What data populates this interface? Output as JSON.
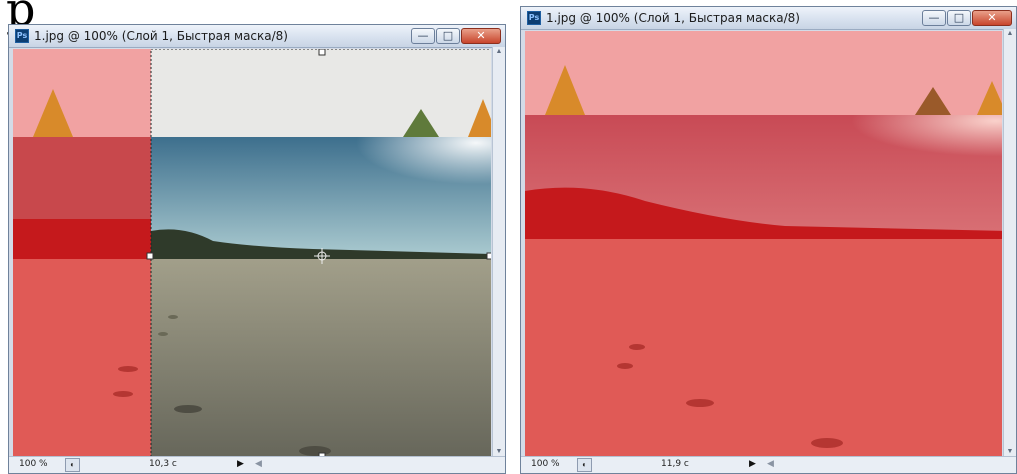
{
  "page": {
    "letter": "р"
  },
  "windows": [
    {
      "id": "left",
      "title": "1.jpg @ 100% (Слой 1, Быстрая маска/8)",
      "app_icon_text": "Ps",
      "status": {
        "zoom": "100 %",
        "info": "10,3 с"
      }
    },
    {
      "id": "right",
      "title": "1.jpg @ 100% (Слой 1, Быстрая маска/8)",
      "app_icon_text": "Ps",
      "status": {
        "zoom": "100 %",
        "info": "11,9 с"
      }
    }
  ],
  "controls": {
    "minimize_glyph": "—",
    "maximize_glyph": "□",
    "close_glyph": "✕",
    "play_glyph": "▶",
    "scroll_left_glyph": "◀",
    "scroll_up_glyph": "▲",
    "scroll_down_glyph": "▼",
    "status_icon_glyph": "◐"
  },
  "colors": {
    "quick_mask_red": "#e0403f",
    "sky": "#4e7f98",
    "sand": "#8c8b79",
    "tree_orange": "#d88a2a"
  }
}
